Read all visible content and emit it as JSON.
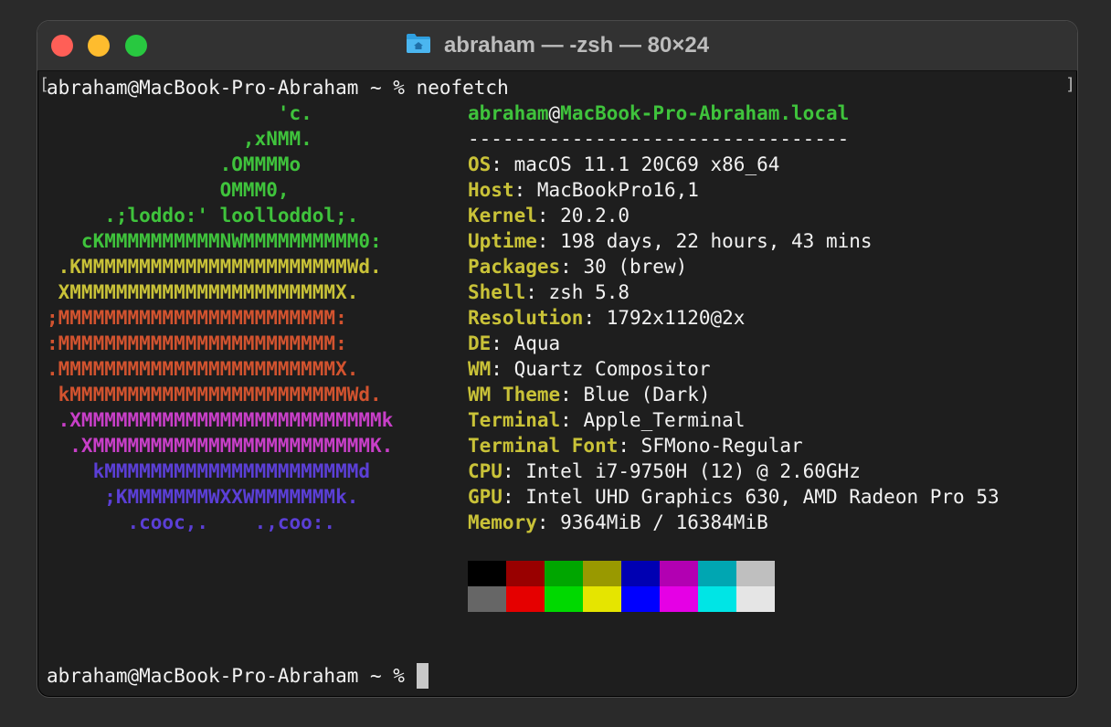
{
  "window": {
    "title": "abraham — -zsh — 80×24"
  },
  "prompt": {
    "first": "abraham@MacBook-Pro-Abraham ~ % neofetch",
    "last": "abraham@MacBook-Pro-Abraham ~ % "
  },
  "ascii_art": [
    {
      "text": "                    'c.",
      "color": "#3fc33c"
    },
    {
      "text": "                 ,xNMM.",
      "color": "#3fc33c"
    },
    {
      "text": "               .OMMMMo",
      "color": "#3fc33c"
    },
    {
      "text": "               OMMM0,",
      "color": "#3fc33c"
    },
    {
      "text": "     .;loddo:' loolloddol;.",
      "color": "#3fc33c"
    },
    {
      "text": "   cKMMMMMMMMMMNWMMMMMMMMMM0:",
      "color": "#3fc33c"
    },
    {
      "text": " .KMMMMMMMMMMMMMMMMMMMMMMMWd.",
      "color": "#c9c238"
    },
    {
      "text": " XMMMMMMMMMMMMMMMMMMMMMMMX.",
      "color": "#c9c238"
    },
    {
      "text": ";MMMMMMMMMMMMMMMMMMMMMMMM:",
      "color": "#d2532f"
    },
    {
      "text": ":MMMMMMMMMMMMMMMMMMMMMMMM:",
      "color": "#d2532f"
    },
    {
      "text": ".MMMMMMMMMMMMMMMMMMMMMMMMX.",
      "color": "#d2532f"
    },
    {
      "text": " kMMMMMMMMMMMMMMMMMMMMMMMMWd.",
      "color": "#d2532f"
    },
    {
      "text": " .XMMMMMMMMMMMMMMMMMMMMMMMMMMk",
      "color": "#c83fc8"
    },
    {
      "text": "  .XMMMMMMMMMMMMMMMMMMMMMMMMK.",
      "color": "#c83fc8"
    },
    {
      "text": "    kMMMMMMMMMMMMMMMMMMMMMMd",
      "color": "#5b3fd6"
    },
    {
      "text": "     ;KMMMMMMMWXXWMMMMMMMk.",
      "color": "#5b3fd6"
    },
    {
      "text": "       .cooc,.    .,coo:.",
      "color": "#5b3fd6"
    }
  ],
  "info": {
    "user": "abraham",
    "at": "@",
    "host": "MacBook-Pro-Abraham.local",
    "separator": "---------------------------------",
    "rows": [
      {
        "key": "OS",
        "value": "macOS 11.1 20C69 x86_64"
      },
      {
        "key": "Host",
        "value": "MacBookPro16,1"
      },
      {
        "key": "Kernel",
        "value": "20.2.0"
      },
      {
        "key": "Uptime",
        "value": "198 days, 22 hours, 43 mins"
      },
      {
        "key": "Packages",
        "value": "30 (brew)"
      },
      {
        "key": "Shell",
        "value": "zsh 5.8"
      },
      {
        "key": "Resolution",
        "value": "1792x1120@2x"
      },
      {
        "key": "DE",
        "value": "Aqua"
      },
      {
        "key": "WM",
        "value": "Quartz Compositor"
      },
      {
        "key": "WM Theme",
        "value": "Blue (Dark)"
      },
      {
        "key": "Terminal",
        "value": "Apple_Terminal"
      },
      {
        "key": "Terminal Font",
        "value": "SFMono-Regular"
      },
      {
        "key": "CPU",
        "value": "Intel i7-9750H (12) @ 2.60GHz"
      },
      {
        "key": "GPU",
        "value": "Intel UHD Graphics 630, AMD Radeon Pro 53"
      },
      {
        "key": "Memory",
        "value": "9364MiB / 16384MiB"
      }
    ]
  },
  "colors": {
    "normal": [
      "#000000",
      "#990000",
      "#00a600",
      "#999900",
      "#0000b2",
      "#b200b2",
      "#00a6b2",
      "#bfbfbf"
    ],
    "bright": [
      "#666666",
      "#e50000",
      "#00d900",
      "#e5e500",
      "#0000ff",
      "#e500e5",
      "#00e5e5",
      "#e5e5e5"
    ]
  }
}
